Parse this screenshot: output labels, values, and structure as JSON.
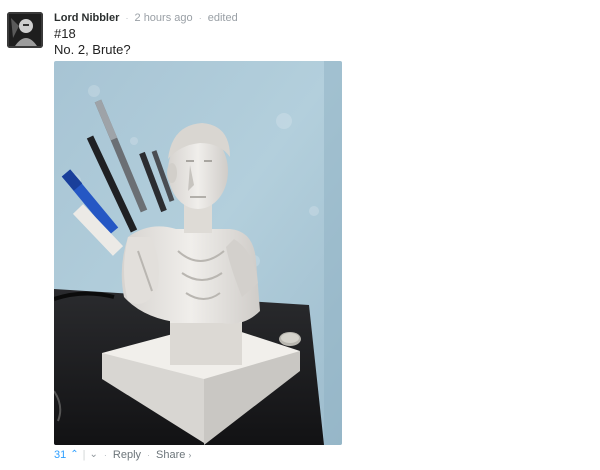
{
  "comment": {
    "author": "Lord Nibbler",
    "timestamp": "2 hours ago",
    "edited": "edited",
    "separator": "·",
    "lines": [
      "#18",
      "No. 2, Brute?"
    ]
  },
  "photo": {
    "icon": "image-photo",
    "description_colors": {
      "wall": "#a9c7d6",
      "desk": "#1c1c1e",
      "statue": "#e9e6e2"
    }
  },
  "footer": {
    "vote_count": "31",
    "upvote_icon": "chevron-up-icon",
    "pipe": "|",
    "downvote_icon": "chevron-down-icon",
    "dot": "·",
    "reply_label": "Reply",
    "share_label": "Share",
    "share_icon": "chevron-right-icon"
  },
  "colors": {
    "accent": "#2e9fff",
    "muted": "#9aa0a6",
    "text": "#222222"
  }
}
